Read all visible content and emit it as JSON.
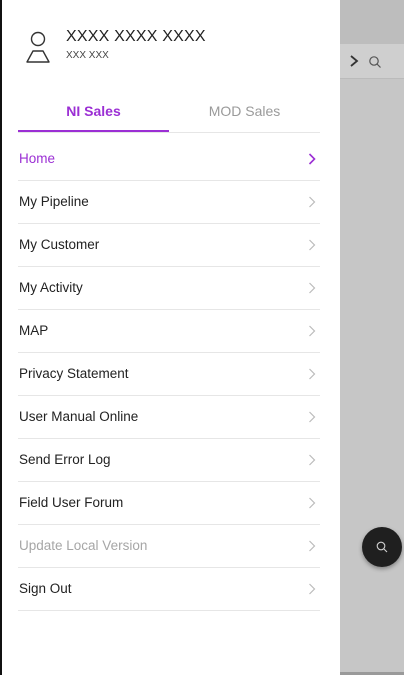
{
  "user": {
    "name": "XXXX XXXX XXXX",
    "subtitle": "XXX XXX"
  },
  "tabs": [
    {
      "label": "NI Sales",
      "active": true
    },
    {
      "label": "MOD Sales",
      "active": false
    }
  ],
  "menu": {
    "items": [
      {
        "label": "Home",
        "state": "active"
      },
      {
        "label": "My Pipeline",
        "state": "normal"
      },
      {
        "label": "My Customer",
        "state": "normal"
      },
      {
        "label": "My Activity",
        "state": "normal"
      },
      {
        "label": "MAP",
        "state": "normal"
      },
      {
        "label": "Privacy Statement",
        "state": "normal"
      },
      {
        "label": "User Manual Online",
        "state": "normal"
      },
      {
        "label": "Send Error Log",
        "state": "normal"
      },
      {
        "label": "Field User Forum",
        "state": "normal"
      },
      {
        "label": "Update Local Version",
        "state": "disabled"
      },
      {
        "label": "Sign Out",
        "state": "normal"
      }
    ]
  },
  "icons": {
    "avatar": "user-outline-icon",
    "chevron": "chevron-right-icon",
    "search": "search-icon",
    "fab": "search-icon"
  },
  "colors": {
    "accent": "#9b2fd4",
    "disabled": "#a6a6a6",
    "text": "#222222"
  }
}
